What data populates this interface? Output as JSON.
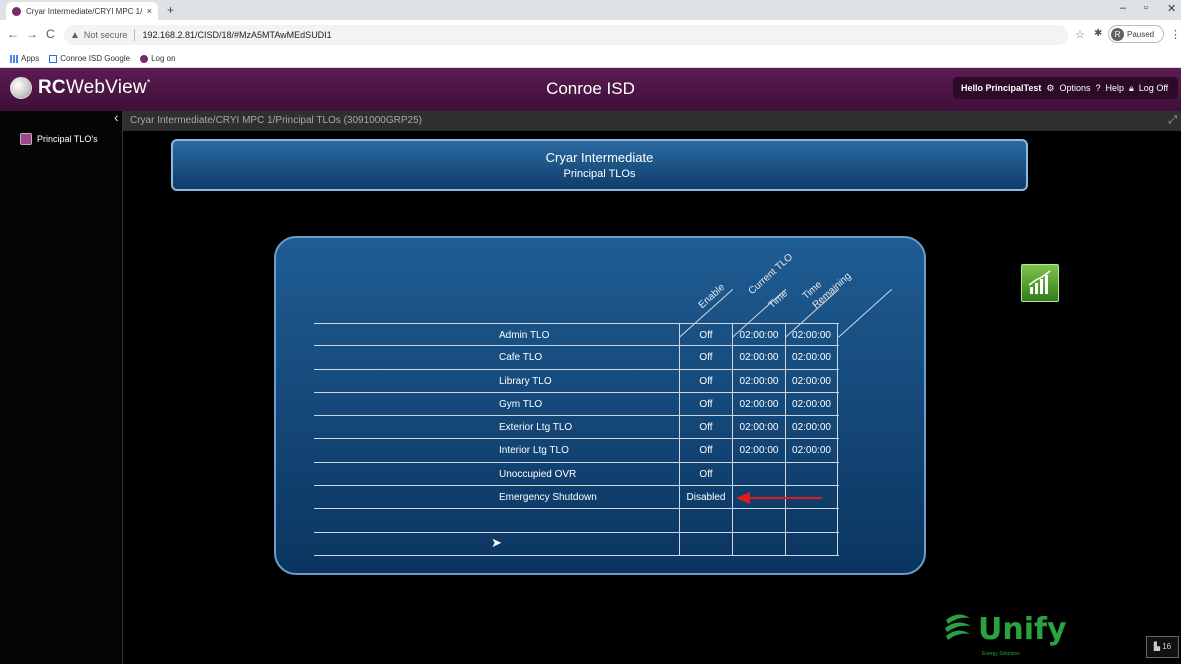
{
  "browser": {
    "tab_title": "Cryar Intermediate/CRYI MPC 1/...",
    "tab_close": "×",
    "new_tab": "+",
    "window_minimize": "–",
    "window_restore": "▫",
    "window_close": "✕",
    "back": "←",
    "forward": "→",
    "reload": "C",
    "security_label": "Not secure",
    "url": "192.168.2.81/CISD/18/#MzA5MTAwMEdSUDI1",
    "profile_initial": "R",
    "profile_label": "Paused",
    "bookmarks": [
      {
        "label": "Apps",
        "icon": "apps-grid-icon"
      },
      {
        "label": "Conroe ISD Google",
        "icon": "calendar-icon"
      },
      {
        "label": "Log on",
        "icon": "rcwebview-icon"
      }
    ]
  },
  "app": {
    "brand_bold": "RC",
    "brand_rest": "WebView",
    "brand_tm": "*",
    "district": "Conroe ISD",
    "greeting": "Hello PrincipalTest",
    "options_label": "Options",
    "help_label": "Help",
    "logoff_label": "Log Off",
    "accent_color": "#5b1c52"
  },
  "sidebar": {
    "items": [
      {
        "label": "Principal TLO's",
        "icon": "schedule-icon"
      }
    ]
  },
  "breadcrumb": "Cryar Intermediate/CRYI MPC 1/Principal TLOs (3091000GRP25)",
  "banner": {
    "title": "Cryar Intermediate",
    "subtitle": "Principal TLOs"
  },
  "tlo_table": {
    "headers": {
      "enable": "Enable",
      "current_line1": "Current TLO",
      "current_line2": "Time",
      "remaining_line1": "Time",
      "remaining_line2": "Remaining"
    },
    "rows": [
      {
        "name": "Admin TLO",
        "enable": "Off",
        "current": "02:00:00",
        "remaining": "02:00:00"
      },
      {
        "name": "Cafe TLO",
        "enable": "Off",
        "current": "02:00:00",
        "remaining": "02:00:00"
      },
      {
        "name": "Library TLO",
        "enable": "Off",
        "current": "02:00:00",
        "remaining": "02:00:00"
      },
      {
        "name": "Gym TLO",
        "enable": "Off",
        "current": "02:00:00",
        "remaining": "02:00:00"
      },
      {
        "name": "Exterior Ltg TLO",
        "enable": "Off",
        "current": "02:00:00",
        "remaining": "02:00:00"
      },
      {
        "name": "Interior Ltg TLO",
        "enable": "Off",
        "current": "02:00:00",
        "remaining": "02:00:00"
      },
      {
        "name": "Unoccupied OVR",
        "enable": "Off",
        "current": "",
        "remaining": ""
      },
      {
        "name": "Emergency Shutdown",
        "enable": "Disabled",
        "current": "",
        "remaining": ""
      },
      {
        "name": "",
        "enable": "",
        "current": "",
        "remaining": ""
      },
      {
        "name": "",
        "enable": "",
        "current": "",
        "remaining": ""
      }
    ]
  },
  "footer": {
    "logo_text": "Unify",
    "logo_sub": "Energy Solutions",
    "badge": "16"
  }
}
